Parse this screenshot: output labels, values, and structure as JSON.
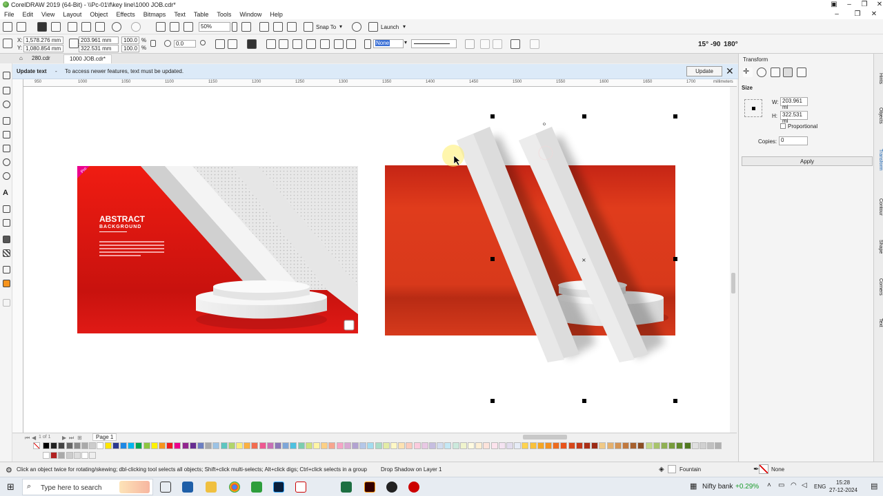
{
  "window": {
    "title": "CorelDRAW 2019 (64-Bit) - \\\\Pc-01\\f\\key line\\1000 JOB.cdr*"
  },
  "menu": [
    "File",
    "Edit",
    "View",
    "Layout",
    "Object",
    "Effects",
    "Bitmaps",
    "Text",
    "Table",
    "Tools",
    "Window",
    "Help"
  ],
  "toolbar": {
    "zoom": "50%",
    "snap_to": "Snap To",
    "launch": "Launch"
  },
  "props": {
    "x": "1,578.276 mm",
    "y": "1,080.854 mm",
    "w": "203.961 mm",
    "h": "322.531 mm",
    "scale_x": "100.0",
    "scale_y": "100.0",
    "pct": "%",
    "angle": "0.0",
    "fill": "None",
    "rot15": "15°",
    "rot90": "-90",
    "rot180": "180°"
  },
  "tabs": [
    "280.cdr",
    "1000 JOB.cdr*"
  ],
  "notice": {
    "title": "Update text",
    "separator": "-",
    "message": "To access newer features, text must be updated.",
    "button": "Update"
  },
  "ruler": {
    "ticks": [
      "950",
      "1000",
      "1050",
      "1100",
      "1150",
      "1200",
      "1250",
      "1300",
      "1350",
      "1400",
      "1450",
      "1500",
      "1550",
      "1600",
      "1650",
      "1700"
    ],
    "unit": "millimeters"
  },
  "artwork": {
    "badge": "Pro",
    "heading": "ABSTRACT",
    "subheading": "BACKGROUND"
  },
  "pages": {
    "counter": "1 of 1",
    "page_tab": "Page 1"
  },
  "docker": {
    "title": "Transform",
    "section": "Size",
    "w_label": "W:",
    "w_value": "203.961 mi",
    "h_label": "H:",
    "h_value": "322.531 mi",
    "proportional": "Proportional",
    "copies_label": "Copies:",
    "copies_value": "0",
    "apply": "Apply",
    "side_tabs": [
      "Hints",
      "Objects",
      "Transform",
      "Contour",
      "Shape",
      "Corners",
      "Text"
    ]
  },
  "status": {
    "hint": "Click an object twice for rotating/skewing; dbl-clicking tool selects all objects; Shift+click multi-selects; Alt+click digs; Ctrl+click selects in a group",
    "layer": "Drop Shadow on Layer 1",
    "fill": "Fountain",
    "outline": "None"
  },
  "taskbar": {
    "search_placeholder": "Type here to search",
    "ticker": "Nifty bank",
    "ticker_change": "+0.29%",
    "lang": "ENG",
    "time": "15:28",
    "date": "27-12-2024"
  },
  "colors": {
    "accent_blue": "#dceaf8",
    "artwork_red": "#e01a16",
    "panel_red": "#d8391b"
  },
  "palette": [
    "#000000",
    "#222222",
    "#444444",
    "#666666",
    "#888888",
    "#aaaaaa",
    "#cccccc",
    "#ffffff",
    "#ffe600",
    "#2b3990",
    "#1e88e5",
    "#00b5ef",
    "#00a651",
    "#8dc63f",
    "#fff200",
    "#f7941d",
    "#ed1c24",
    "#ec008c",
    "#92278f",
    "#662d91",
    "#6c7fc2",
    "#a7a9ac",
    "#9cc3e5",
    "#5ec5c0",
    "#b0d56b",
    "#f9ed7f",
    "#fbb040",
    "#f26c4f",
    "#ee5891",
    "#c770b5",
    "#8c77b8",
    "#7ea6d8",
    "#4ec1e0",
    "#7ccdb0",
    "#cfe27e",
    "#fff5a5",
    "#fdd085",
    "#f7a58e",
    "#f6a5c6",
    "#d8a9d3",
    "#b2a2d1",
    "#b5c7e8",
    "#a3dcef",
    "#a9dcc7",
    "#e3eca5",
    "#fff8c6",
    "#fde2b2",
    "#fbcbbd",
    "#fbcbdd",
    "#e8c8e4",
    "#c6bee0",
    "#d2dcf0",
    "#c4e8f5",
    "#cbe9dc",
    "#f0f4cd",
    "#fffae0",
    "#feefd4",
    "#fde3da",
    "#fde3ed",
    "#f4e3f1",
    "#e2dcee",
    "#e6ecf7",
    "#ffd34e",
    "#f9c13b",
    "#f6a623",
    "#f39121",
    "#ed6c1f",
    "#e8541c",
    "#d6471b",
    "#c2391a",
    "#ab2e16",
    "#9c2a14",
    "#f0c987",
    "#e5b06d",
    "#d49454",
    "#c1793f",
    "#a6612f",
    "#8c4e25",
    "#c2d88a",
    "#a8c46c",
    "#8fb052",
    "#779c3c",
    "#628a2c",
    "#517921",
    "#e0e0e0",
    "#d0d0d0",
    "#c0c0c0",
    "#b0b0b0",
    "#a0a0a0",
    "#909090"
  ],
  "palette_doc": [
    "#ffffff",
    "#b22222",
    "#aaaaaa",
    "#cccccc",
    "#dddddd",
    "#ffffff",
    "#eeeeee"
  ]
}
